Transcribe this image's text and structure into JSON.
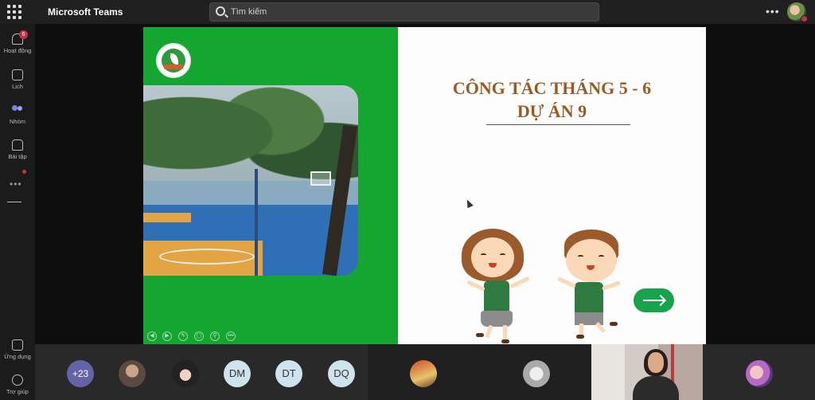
{
  "app": {
    "title": "Microsoft Teams"
  },
  "search": {
    "placeholder": "Tìm kiếm"
  },
  "header": {
    "more_label": "•••"
  },
  "rail": {
    "items": [
      {
        "label": "Hoạt động",
        "badge": "6"
      },
      {
        "label": "Lịch"
      },
      {
        "label": "Nhóm"
      },
      {
        "label": "Bài tập"
      },
      {
        "label": "Ứng dụng"
      },
      {
        "label": "Trợ giúp"
      }
    ],
    "more_label": "•••"
  },
  "slide": {
    "title_line1": "CÔNG TÁC THÁNG 5 - 6",
    "title_line2": "DỰ ÁN 9",
    "colors": {
      "left_panel": "#15a632",
      "title": "#9c5a22",
      "button": "#17a34a"
    }
  },
  "slide_controls": [
    "◀",
    "▶",
    "✎",
    "▢",
    "⚲",
    "•••"
  ],
  "participants": {
    "overflow_count": "+23",
    "initials": [
      "DM",
      "DT",
      "DQ"
    ]
  }
}
